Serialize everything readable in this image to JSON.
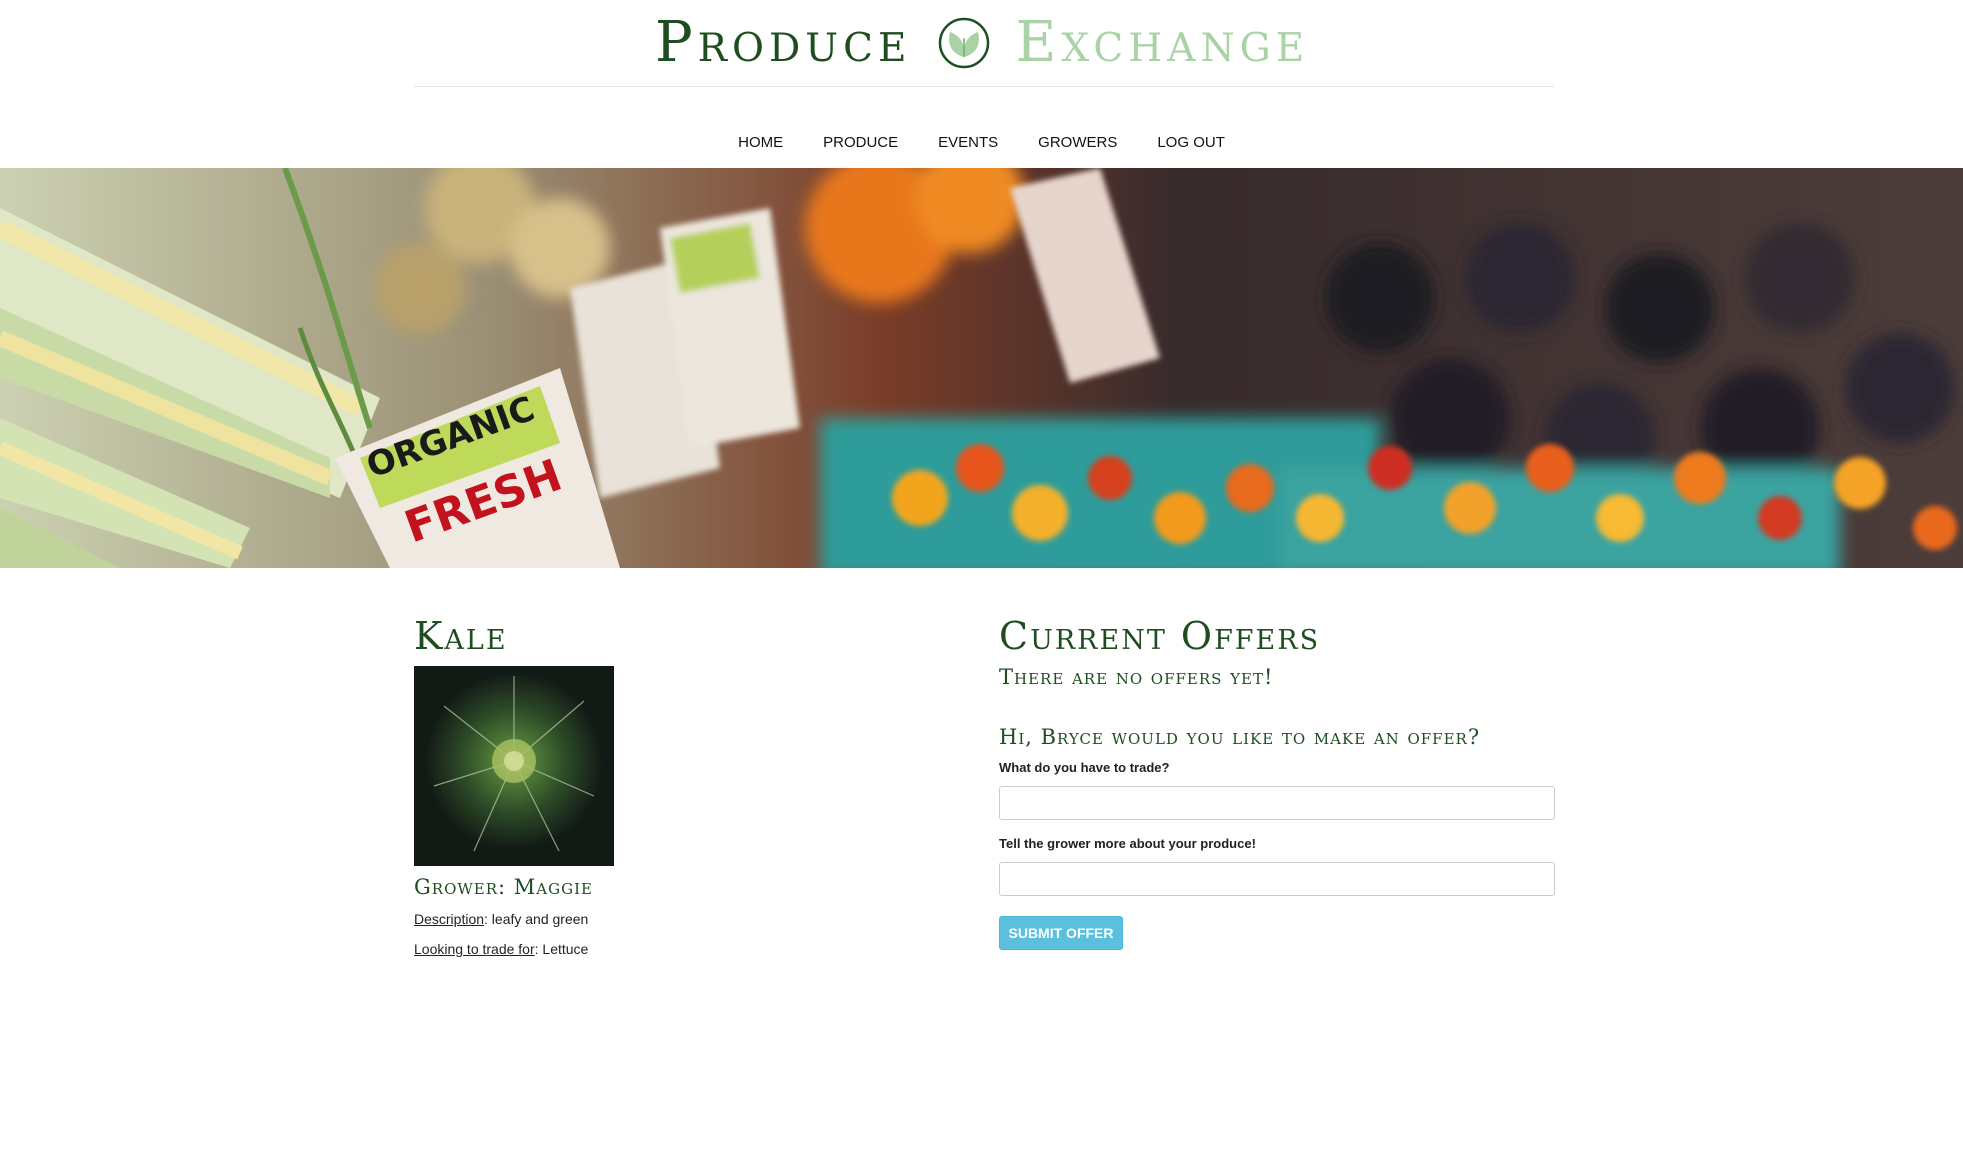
{
  "brand": {
    "name_first": "Produce",
    "name_second": "Exchange",
    "icon": "leaf-logo-icon",
    "colors": {
      "dark_green": "#1e4d20",
      "light_green": "#a9d3a6"
    }
  },
  "nav": {
    "items": [
      {
        "label": "HOME"
      },
      {
        "label": "PRODUCE"
      },
      {
        "label": "EVENTS"
      },
      {
        "label": "GROWERS"
      },
      {
        "label": "LOG OUT"
      }
    ]
  },
  "product": {
    "title": "Kale",
    "image": "kale-photo",
    "grower": "Grower: Maggie",
    "description_label": "Description",
    "description": ": leafy and green",
    "trade_label": "Looking to trade for",
    "trade_value": ": Lettuce"
  },
  "offers": {
    "title": "Current Offers",
    "empty_message": "There are no offers yet!",
    "prompt": "Hi, Bryce would you like to make an offer?",
    "field1_label": "What do you have to trade?",
    "field1_value": "",
    "field2_label": "Tell the grower more about your produce!",
    "field2_value": "",
    "submit_label": "SUBMIT OFFER",
    "submit_color": "#5bc0de"
  }
}
